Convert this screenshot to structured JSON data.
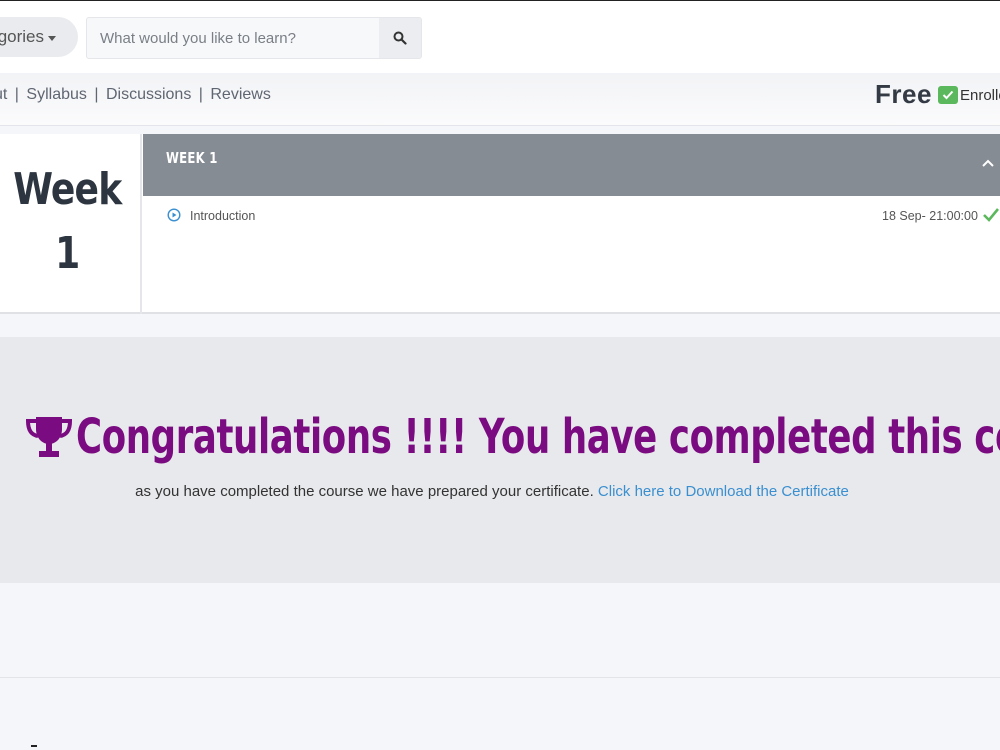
{
  "header": {
    "categories_label": "gories",
    "search": {
      "placeholder": "What would you like to learn?",
      "icon": "search-icon"
    }
  },
  "course_nav": {
    "links": [
      "ut",
      "Syllabus",
      "Discussions",
      "Reviews"
    ],
    "separator": "|",
    "price": "Free",
    "enrolled_label": "Enrolle",
    "enrolled_color": "#5cb85c"
  },
  "week": {
    "side_title": "Week",
    "side_number": "1",
    "header_title": "WEEK 1",
    "header_color": "#868c94",
    "lessons": [
      {
        "title": "Introduction",
        "date": "18 Sep- 21:00:00",
        "completed": true
      }
    ]
  },
  "congrats": {
    "heading": "Congratulations !!!! You have completed this course.",
    "heading_color": "#7a0b80",
    "subtext": "as you have completed the course we have prepared your certificate.",
    "link_text": "Click here to Download the Certificate",
    "link_color": "#3a8fd0"
  }
}
